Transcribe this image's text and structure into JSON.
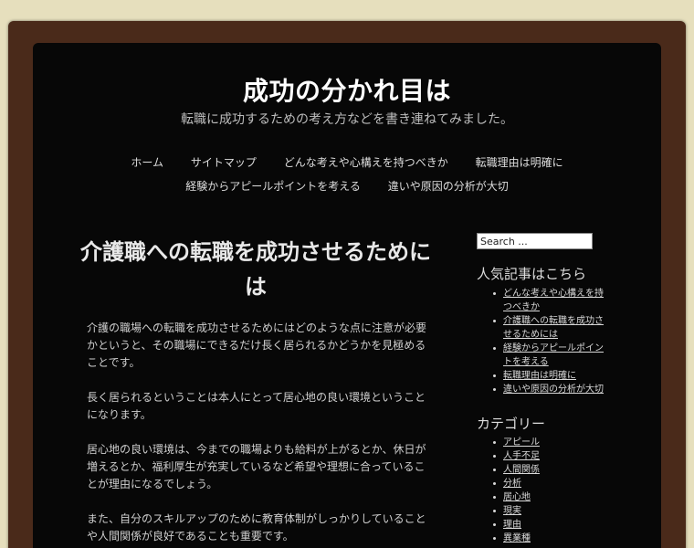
{
  "header": {
    "title": "成功の分かれ目は",
    "description": "転職に成功するための考え方などを書き連ねてみました。"
  },
  "nav": {
    "row1": [
      "ホーム",
      "サイトマップ",
      "どんな考えや心構えを持つべきか",
      "転職理由は明確に"
    ],
    "row2": [
      "経験からアピールポイントを考える",
      "違いや原因の分析が大切"
    ]
  },
  "post": {
    "title": "介護職への転職を成功させるためには",
    "paragraphs": [
      "介護の職場への転職を成功させるためにはどのような点に注意が必要かというと、その職場にできるだけ長く居られるかどうかを見極めることです。",
      "長く居られるということは本人にとって居心地の良い環境ということになります。",
      "居心地の良い環境は、今までの職場よりも給料が上がるとか、休日が増えるとか、福利厚生が充実しているなど希望や理想に合っていることが理由になるでしょう。",
      "また、自分のスキルアップのために教育体制がしっかりしていることや人間関係が良好であることも重要です。"
    ]
  },
  "sidebar": {
    "search_placeholder": "Search ...",
    "popular_title": "人気記事はこちら",
    "popular_items": [
      "どんな考えや心構えを持つべきか",
      "介護職への転職を成功させるためには",
      "経験からアピールポイントを考える",
      "転職理由は明確に",
      "違いや原因の分析が大切"
    ],
    "category_title": "カテゴリー",
    "category_items": [
      "アピール",
      "人手不足",
      "人間関係",
      "分析",
      "居心地",
      "現実",
      "理由",
      "異業種"
    ]
  }
}
